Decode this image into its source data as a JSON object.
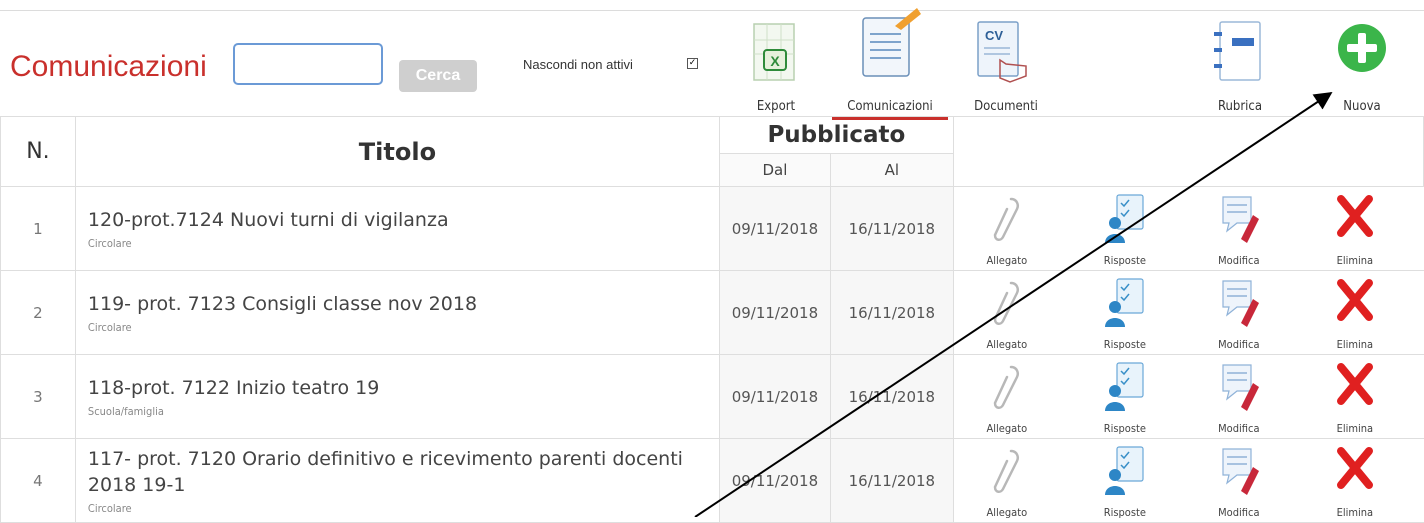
{
  "toolbar": {
    "title": "Comunicazioni",
    "search_placeholder": "",
    "search_button": "Cerca",
    "hide_inactive_label": "Nascondi non attivi",
    "hide_inactive_checked": true,
    "tools": [
      {
        "label": "Export",
        "icon": "excel-export-icon"
      },
      {
        "label": "Comunicazioni",
        "icon": "document-pencil-icon",
        "active": true
      },
      {
        "label": "Documenti",
        "icon": "cv-document-icon"
      },
      {
        "label": "Rubrica",
        "icon": "address-book-icon"
      },
      {
        "label": "Nuova",
        "icon": "plus-circle-icon"
      }
    ]
  },
  "table": {
    "col_n": "N.",
    "col_title": "Titolo",
    "col_published": "Pubblicato",
    "col_from": "Dal",
    "col_to": "Al",
    "action_labels": {
      "attachment": "Allegato",
      "answers": "Risposte",
      "edit": "Modifica",
      "delete": "Elimina"
    },
    "rows": [
      {
        "n": "1",
        "title": "120-prot.7124 Nuovi turni di vigilanza",
        "category": "Circolare",
        "from": "09/11/2018",
        "to": "16/11/2018"
      },
      {
        "n": "2",
        "title": "119- prot. 7123 Consigli classe nov 2018",
        "category": "Circolare",
        "from": "09/11/2018",
        "to": "16/11/2018"
      },
      {
        "n": "3",
        "title": "118-prot. 7122 Inizio teatro 19",
        "category": "Scuola/famiglia",
        "from": "09/11/2018",
        "to": "16/11/2018"
      },
      {
        "n": "4",
        "title": "117- prot. 7120 Orario definitivo e ricevimento parenti docenti 2018 19-1",
        "category": "Circolare",
        "from": "09/11/2018",
        "to": "16/11/2018"
      }
    ]
  },
  "colors": {
    "title_red": "#c9302c",
    "green_add": "#3bb54a",
    "delete_red": "#e02020",
    "answers_blue": "#3aa0d8"
  }
}
